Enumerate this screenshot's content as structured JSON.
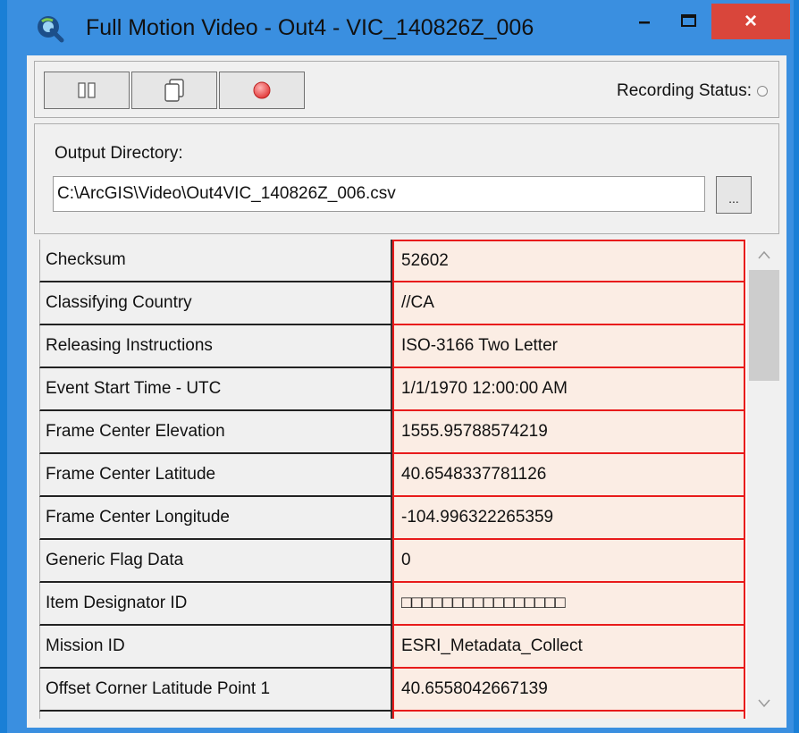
{
  "window": {
    "title": "Full Motion Video - Out4 - VIC_140826Z_006",
    "app_icon": "q-logo-icon",
    "minimize_label": "–",
    "maximize_label": "☐",
    "close_label": "×"
  },
  "toolbar": {
    "buttons": [
      {
        "name": "pause-button",
        "icon": "pause-icon"
      },
      {
        "name": "copy-button",
        "icon": "copy-icon"
      },
      {
        "name": "record-button",
        "icon": "record-icon"
      }
    ],
    "recording_status_label": "Recording Status:"
  },
  "output": {
    "label": "Output Directory:",
    "path": "C:\\ArcGIS\\Video\\Out4VIC_140826Z_006.csv",
    "browse_label": "..."
  },
  "metadata": {
    "rows": [
      {
        "name": "Checksum",
        "value": "52602"
      },
      {
        "name": "Classifying Country",
        "value": "//CA"
      },
      {
        "name": "Releasing Instructions",
        "value": "ISO-3166 Two Letter"
      },
      {
        "name": "Event Start Time - UTC",
        "value": "1/1/1970 12:00:00 AM"
      },
      {
        "name": "Frame Center Elevation",
        "value": "1555.95788574219"
      },
      {
        "name": "Frame Center Latitude",
        "value": "40.6548337781126"
      },
      {
        "name": "Frame Center Longitude",
        "value": "-104.996322265359"
      },
      {
        "name": "Generic Flag Data",
        "value": "0"
      },
      {
        "name": "Item Designator ID",
        "value": "□□□□□□□□□□□□□□□□"
      },
      {
        "name": "Mission ID",
        "value": "ESRI_Metadata_Collect"
      },
      {
        "name": "Offset Corner Latitude Point 1",
        "value": "40.6558042667139"
      },
      {
        "name": "",
        "value": ""
      }
    ]
  },
  "colors": {
    "title_bar": "#3a8fe0",
    "close_button": "#d9463b",
    "value_cell_border": "#e81b1b",
    "value_cell_bg": "#fbede4"
  }
}
